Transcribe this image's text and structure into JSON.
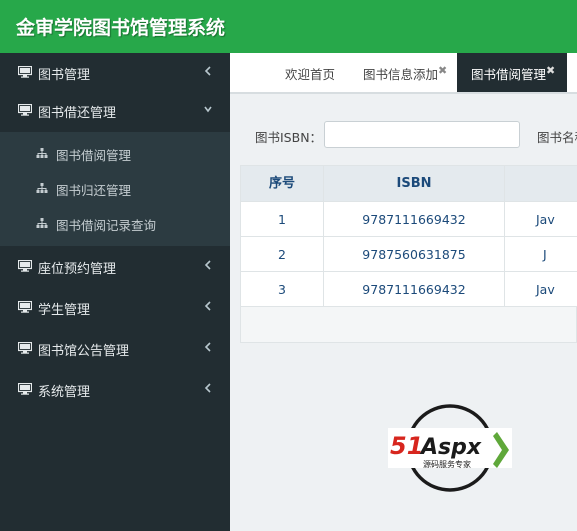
{
  "app": {
    "title": "金审学院图书馆管理系统"
  },
  "sidebar": {
    "items": [
      {
        "label": "图书管理",
        "icon": "monitor-icon",
        "expanded": false
      },
      {
        "label": "图书借还管理",
        "icon": "monitor-icon",
        "expanded": true,
        "children": [
          {
            "label": "图书借阅管理",
            "icon": "sitemap-icon"
          },
          {
            "label": "图书归还管理",
            "icon": "sitemap-icon"
          },
          {
            "label": "图书借阅记录查询",
            "icon": "sitemap-icon"
          }
        ]
      },
      {
        "label": "座位预约管理",
        "icon": "monitor-icon",
        "expanded": false
      },
      {
        "label": "学生管理",
        "icon": "monitor-icon",
        "expanded": false
      },
      {
        "label": "图书馆公告管理",
        "icon": "monitor-icon",
        "expanded": false
      },
      {
        "label": "系统管理",
        "icon": "monitor-icon",
        "expanded": false
      }
    ]
  },
  "tabs": [
    {
      "label": "欢迎首页",
      "closable": false,
      "active": false
    },
    {
      "label": "图书信息添加",
      "closable": true,
      "active": false
    },
    {
      "label": "图书借阅管理",
      "closable": true,
      "active": true
    }
  ],
  "search": {
    "isbn_label": "图书ISBN：",
    "isbn_value": "",
    "name_label": "图书名称"
  },
  "table": {
    "headers": [
      "序号",
      "ISBN",
      ""
    ],
    "rows": [
      {
        "no": "1",
        "isbn": "9787111669432",
        "name": "Jav"
      },
      {
        "no": "2",
        "isbn": "9787560631875",
        "name": "J"
      },
      {
        "no": "3",
        "isbn": "9787111669432",
        "name": "Jav"
      }
    ]
  },
  "logo": {
    "brand_a": "51",
    "brand_b": "Aspx",
    "slogan": "源码服务专家"
  },
  "colors": {
    "header_green": "#27a84a",
    "sidebar_bg": "#222d32",
    "table_text": "#1c4a7a",
    "logo_red": "#d7261e",
    "logo_green": "#5fa83a"
  }
}
